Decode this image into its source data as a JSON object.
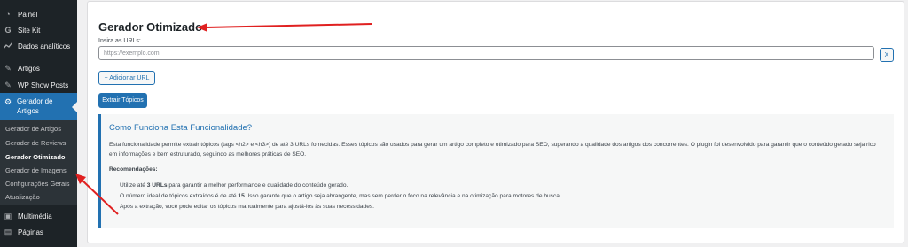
{
  "sidebar": {
    "items": [
      {
        "label": "Painel",
        "icon": "dashboard-icon"
      },
      {
        "label": "Site Kit",
        "icon": "sitekit-icon"
      },
      {
        "label": "Dados analíticos",
        "icon": "analytics-icon"
      },
      {
        "label": "Artigos",
        "icon": "pin-icon"
      },
      {
        "label": "WP Show Posts",
        "icon": "pin-icon"
      }
    ],
    "active": {
      "label": "Gerador de Artigos",
      "icon": "gear-icon"
    },
    "submenu": [
      "Gerador de Artigos",
      "Gerador de Reviews",
      "Gerador Otimizado",
      "Gerador de Imagens",
      "Configurações Gerais",
      "Atualização"
    ],
    "bottom_items": [
      {
        "label": "Multimédia",
        "icon": "media-icon"
      },
      {
        "label": "Páginas",
        "icon": "pages-icon"
      }
    ]
  },
  "main": {
    "title": "Gerador Otimizado",
    "url_label": "Insira as URLs:",
    "url_placeholder": "https://exemplo.com",
    "remove_label": "X",
    "add_url_label": "+ Adicionar URL",
    "extract_label": "Extrair Tópicos"
  },
  "info": {
    "title": "Como Funciona Esta Funcionalidade?",
    "description": "Esta funcionalidade permite extrair tópicos (tags <h2> e <h3>) de até 3 URLs fornecidas. Esses tópicos são usados para gerar um artigo completo e otimizado para SEO, superando a qualidade dos artigos dos concorrentes. O plugin foi desenvolvido para garantir que o conteúdo gerado seja rico em informações e bem estruturado, seguindo as melhores práticas de SEO.",
    "recommendations_title": "Recomendações:",
    "rec1_pre": "Utilize até ",
    "rec1_bold": "3 URLs",
    "rec1_post": " para garantir a melhor performance e qualidade do conteúdo gerado.",
    "rec2_pre": "O número ideal de tópicos extraídos é de até ",
    "rec2_bold": "15",
    "rec2_post": ". Isso garante que o artigo seja abrangente, mas sem perder o foco na relevância e na otimização para motores de busca.",
    "rec3": "Após a extração, você pode editar os tópicos manualmente para ajustá-los às suas necessidades."
  },
  "colors": {
    "sidebar_bg": "#1d2327",
    "accent": "#2271b1",
    "arrow": "#e02020"
  }
}
